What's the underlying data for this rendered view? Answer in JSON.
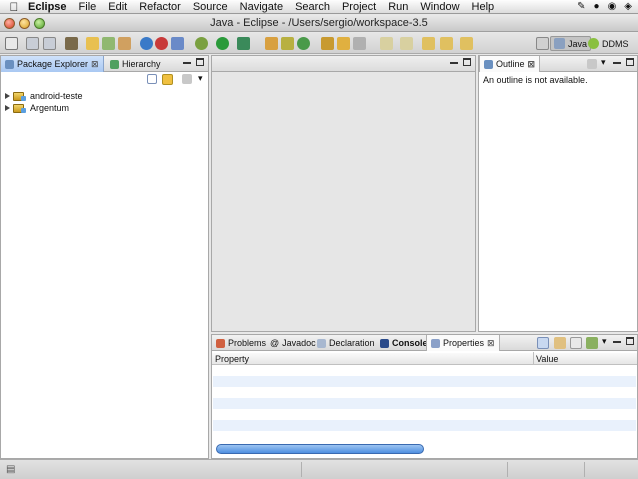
{
  "menubar": {
    "app": "Eclipse",
    "items": [
      "File",
      "Edit",
      "Refactor",
      "Source",
      "Navigate",
      "Search",
      "Project",
      "Run",
      "Window",
      "Help"
    ]
  },
  "window": {
    "title": "Java - Eclipse - /Users/sergio/workspace-3.5"
  },
  "perspectives": [
    {
      "label": "Java",
      "active": true
    },
    {
      "label": "DDMS",
      "active": false
    }
  ],
  "package_explorer": {
    "tabs": [
      {
        "label": "Package Explorer",
        "close": "⊠"
      },
      {
        "label": "Hierarchy"
      }
    ],
    "tree": [
      {
        "label": "android-teste"
      },
      {
        "label": "Argentum"
      }
    ]
  },
  "outline": {
    "tab_label": "Outline",
    "close": "⊠",
    "message": "An outline is not available."
  },
  "bottom": {
    "tabs": [
      {
        "label": "Problems"
      },
      {
        "label": "Javadoc"
      },
      {
        "label": "Declaration"
      },
      {
        "label": "Console"
      },
      {
        "label": "Properties",
        "close": "⊠"
      }
    ],
    "columns": [
      "Property",
      "Value"
    ]
  },
  "colors": {
    "accent_tab": "#a9c8f2",
    "row_stripe": "#e9f1fc",
    "progress": "#4f8fe0"
  }
}
